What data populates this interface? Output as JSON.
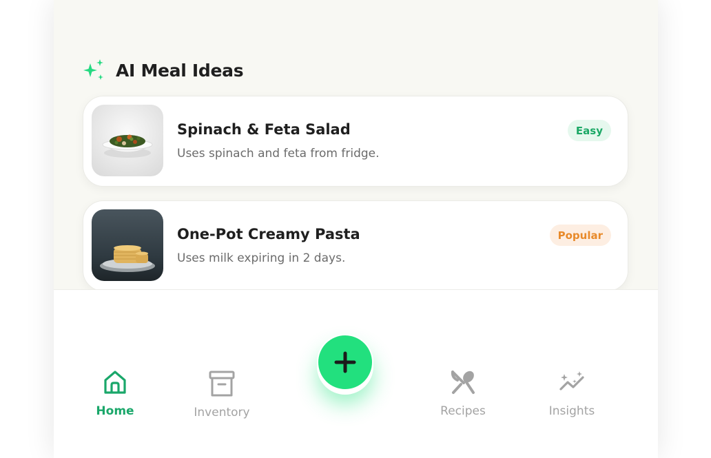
{
  "section": {
    "title": "AI Meal Ideas",
    "icon": "sparkles-icon"
  },
  "meals": [
    {
      "title": "Spinach & Feta Salad",
      "subtitle": "Uses spinach and feta from fridge.",
      "badge": "Easy",
      "badge_color": "#1ca866"
    },
    {
      "title": "One-Pot Creamy Pasta",
      "subtitle": "Uses milk expiring in 2 days.",
      "badge": "Popular",
      "badge_color": "#e88a2a"
    }
  ],
  "nav": {
    "items": [
      {
        "label": "Home",
        "icon": "home-icon",
        "active": true
      },
      {
        "label": "Inventory",
        "icon": "archive-box-icon",
        "active": false
      },
      {
        "label": "Recipes",
        "icon": "fork-spoon-icon",
        "active": false
      },
      {
        "label": "Insights",
        "icon": "trend-sparkle-icon",
        "active": false
      }
    ],
    "fab_icon": "plus-icon"
  },
  "colors": {
    "accent": "#22e07e",
    "active_text": "#1aa76a",
    "inactive": "#a3a3a3"
  }
}
